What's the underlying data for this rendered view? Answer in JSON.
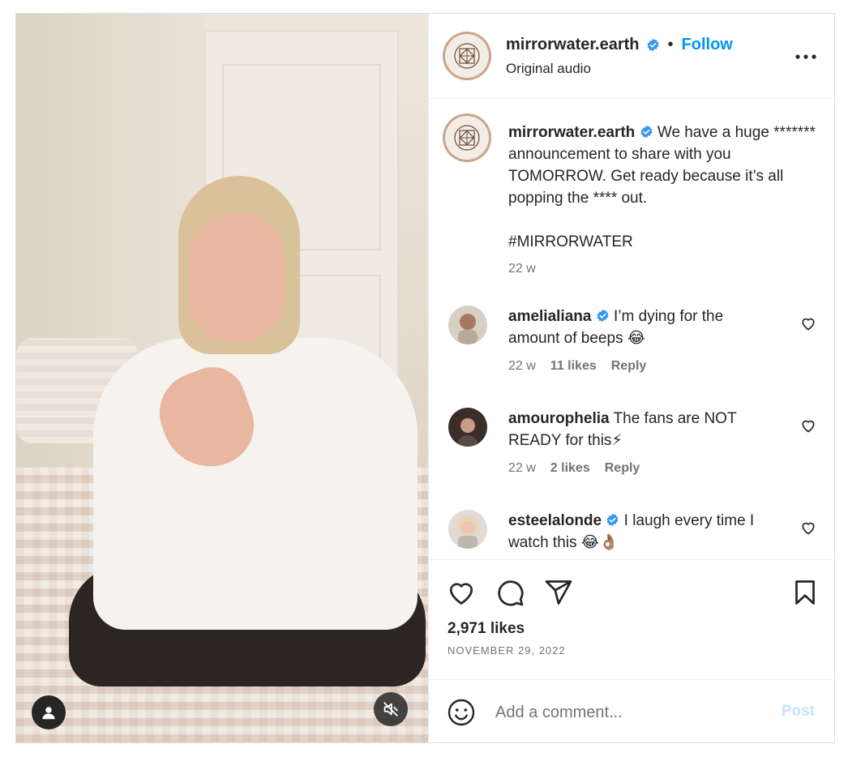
{
  "post": {
    "account": {
      "username": "mirrorwater.earth",
      "verified": true,
      "follow_label": "Follow",
      "separator": "•",
      "audio_label": "Original audio"
    },
    "caption": {
      "username": "mirrorwater.earth",
      "text": "We have a huge ******* announcement to share with you TOMORROW. Get ready because it’s all popping the **** out.",
      "hashtag": "#MIRRORWATER",
      "time": "22 w"
    },
    "comments": [
      {
        "username": "amelialiana",
        "verified": true,
        "text": "I’m dying for the amount of beeps 😂",
        "time": "22 w",
        "likes": "11 likes",
        "reply": "Reply"
      },
      {
        "username": "amourophelia",
        "verified": false,
        "text": "The fans are NOT READY for this⚡",
        "time": "22 w",
        "likes": "2 likes",
        "reply": "Reply"
      },
      {
        "username": "esteelalonde",
        "verified": true,
        "text": "I laugh every time I watch this 😂👌🏽",
        "time": "",
        "likes": "",
        "reply": ""
      }
    ],
    "likes_count": "2,971 likes",
    "date": "NOVEMBER 29, 2022",
    "add_comment_placeholder": "Add a comment...",
    "post_button": "Post"
  },
  "icons": {
    "more": "more-options-icon",
    "like": "heart-icon",
    "comment": "comment-bubble-icon",
    "share": "paper-plane-icon",
    "save": "bookmark-icon",
    "emoji": "smiley-icon",
    "user_tag": "user-icon",
    "mute": "muted-speaker-icon",
    "verified": "verified-badge-icon"
  },
  "colors": {
    "link_blue": "#0095f6",
    "verified_blue": "#3897f0",
    "muted_text": "#737373",
    "post_disabled": "#c5e4fc"
  }
}
